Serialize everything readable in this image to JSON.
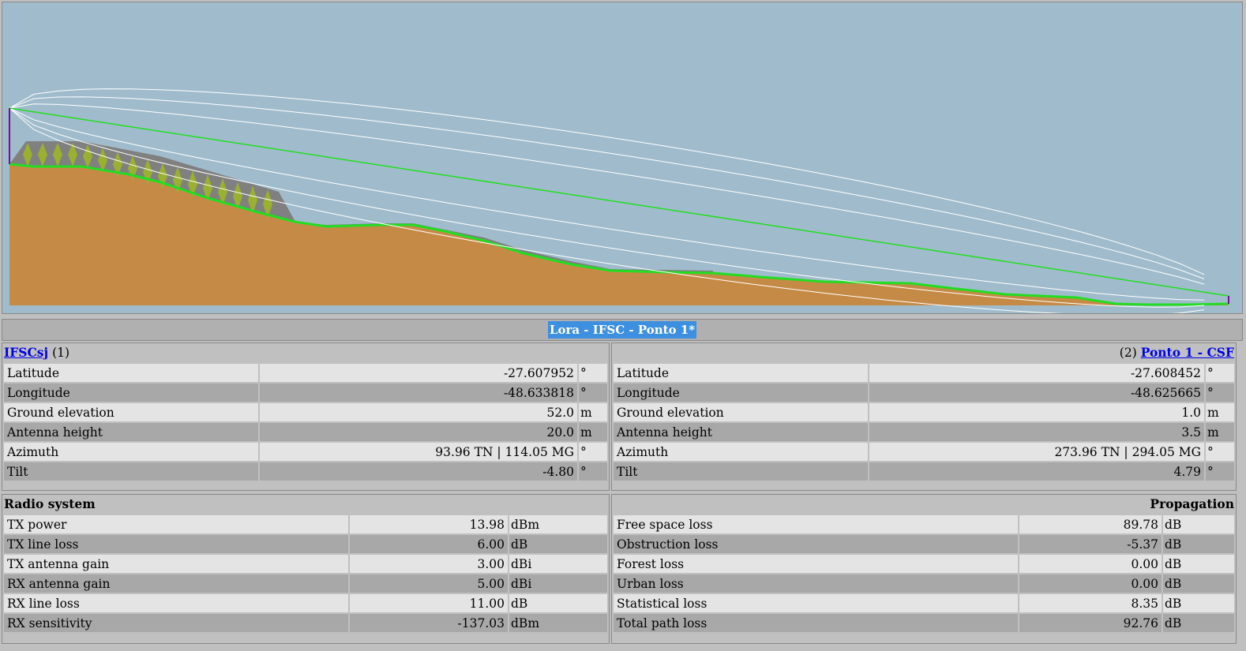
{
  "title": "Lora - IFSC - Ponto 1*",
  "colors": {
    "sky": "#a0bccc",
    "ground": "#c68a47",
    "los_line": "#22dd22",
    "fresnel": "#ffffff",
    "forest_fill": "#808080",
    "tree": "#9ab030",
    "antenna": "#7a0a9a"
  },
  "site_left": {
    "name": "IFSCsj",
    "index": "(1)",
    "rows": [
      {
        "label": "Latitude",
        "value": "-27.607952",
        "unit": "°"
      },
      {
        "label": "Longitude",
        "value": "-48.633818",
        "unit": "°"
      },
      {
        "label": "Ground elevation",
        "value": "52.0",
        "unit": "m"
      },
      {
        "label": "Antenna height",
        "value": "20.0",
        "unit": "m"
      },
      {
        "label": "Azimuth",
        "value": "93.96 TN  |  114.05 MG",
        "unit": "°"
      },
      {
        "label": "Tilt",
        "value": "-4.80",
        "unit": "°"
      }
    ]
  },
  "site_right": {
    "name": "Ponto 1 - CSF",
    "index": "(2)",
    "rows": [
      {
        "label": "Latitude",
        "value": "-27.608452",
        "unit": "°"
      },
      {
        "label": "Longitude",
        "value": "-48.625665",
        "unit": "°"
      },
      {
        "label": "Ground elevation",
        "value": "1.0",
        "unit": "m"
      },
      {
        "label": "Antenna height",
        "value": "3.5",
        "unit": "m"
      },
      {
        "label": "Azimuth",
        "value": "273.96 TN  |  294.05 MG",
        "unit": "°"
      },
      {
        "label": "Tilt",
        "value": "4.79",
        "unit": "°"
      }
    ]
  },
  "radio_system": {
    "heading": "Radio system",
    "rows": [
      {
        "label": "TX power",
        "value": "13.98",
        "unit": "dBm"
      },
      {
        "label": "TX line loss",
        "value": "6.00",
        "unit": "dB"
      },
      {
        "label": "TX antenna gain",
        "value": "3.00",
        "unit": "dBi"
      },
      {
        "label": "RX antenna gain",
        "value": "5.00",
        "unit": "dBi"
      },
      {
        "label": "RX line loss",
        "value": "11.00",
        "unit": "dB"
      },
      {
        "label": "RX sensitivity",
        "value": "-137.03",
        "unit": "dBm"
      }
    ]
  },
  "propagation": {
    "heading": "Propagation",
    "rows": [
      {
        "label": "Free space loss",
        "value": "89.78",
        "unit": "dB"
      },
      {
        "label": "Obstruction loss",
        "value": "-5.37",
        "unit": "dB"
      },
      {
        "label": "Forest loss",
        "value": "0.00",
        "unit": "dB"
      },
      {
        "label": "Urban loss",
        "value": "0.00",
        "unit": "dB"
      },
      {
        "label": "Statistical loss",
        "value": "8.35",
        "unit": "dB"
      },
      {
        "label": "Total path loss",
        "value": "92.76",
        "unit": "dB"
      }
    ]
  }
}
